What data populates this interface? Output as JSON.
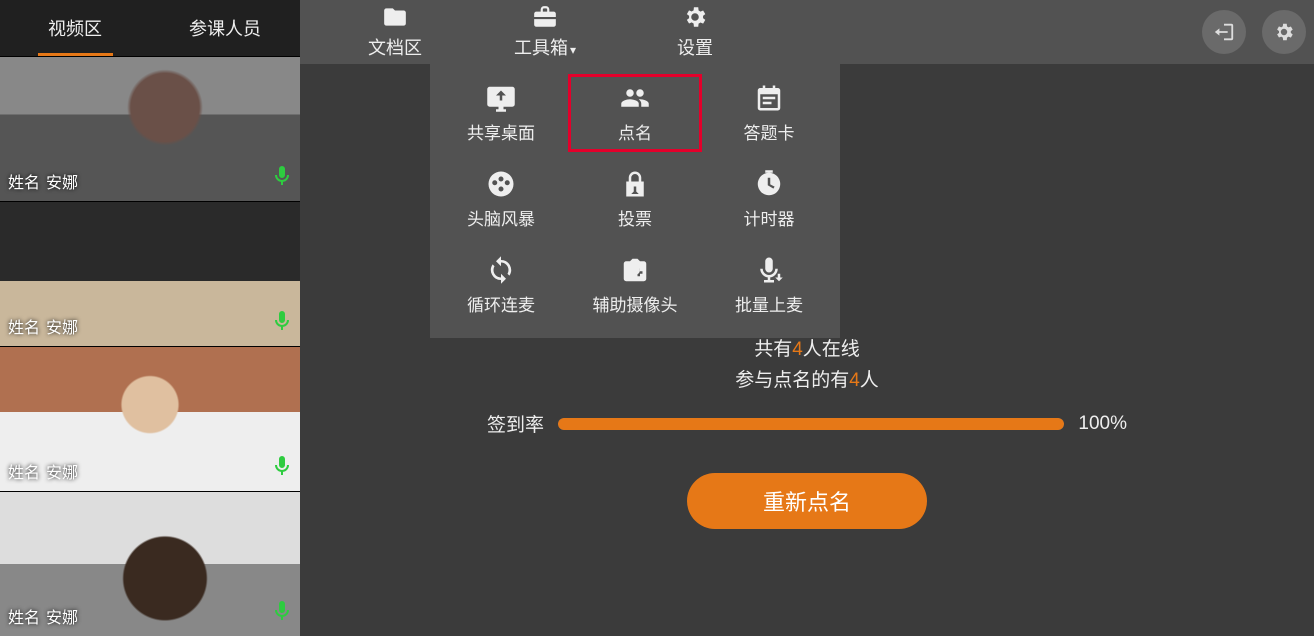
{
  "left": {
    "tabs": {
      "video": "视频区",
      "people": "参课人员"
    },
    "name_label": "姓名",
    "items": [
      {
        "name": "安娜"
      },
      {
        "name": "安娜"
      },
      {
        "name": "安娜"
      },
      {
        "name": "安娜"
      }
    ]
  },
  "menubar": {
    "doc": "文档区",
    "tools": "工具箱",
    "settings": "设置"
  },
  "toolbox": {
    "share": "共享桌面",
    "roll": "点名",
    "card": "答题卡",
    "brain": "头脑风暴",
    "vote": "投票",
    "timer": "计时器",
    "loop": "循环连麦",
    "cam2": "辅助摄像头",
    "bulkmic": "批量上麦"
  },
  "result": {
    "online_pre": "共有",
    "online_n": "4",
    "online_post": "人在线",
    "join_pre": "参与点名的有",
    "join_n": "4",
    "join_post": "人",
    "rate_label": "签到率",
    "rate_pct": "100%",
    "again": "重新点名"
  }
}
